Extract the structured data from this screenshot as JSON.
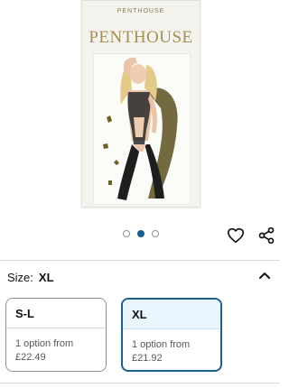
{
  "product_image": {
    "top_label": "PENTHOUSE",
    "brand": "PENTHOUSE",
    "carousel": {
      "count": 3,
      "active_index": 1
    }
  },
  "actions": {
    "wishlist_icon": "heart-icon",
    "share_icon": "share-icon"
  },
  "size_selector": {
    "label": "Size:",
    "selected": "XL",
    "options": [
      {
        "size": "S-L",
        "line1": "1 option from",
        "price": "£22.49",
        "selected": false
      },
      {
        "size": "XL",
        "line1": "1 option from",
        "price": "£21.92",
        "selected": true
      }
    ]
  },
  "colors": {
    "accent": "#1c5e8e",
    "selected_bg": "#eaf6fe",
    "brand_gold": "#a48f54"
  }
}
